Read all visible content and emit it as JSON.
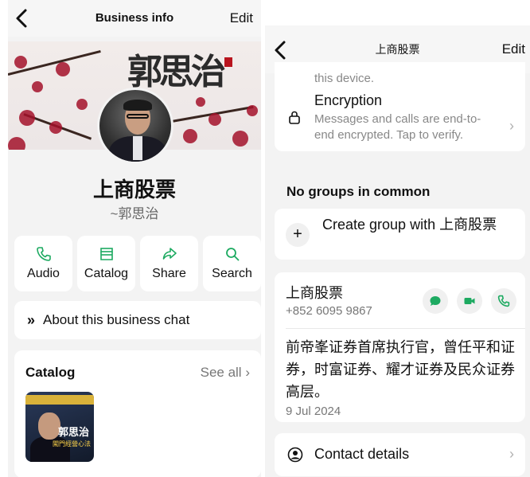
{
  "left": {
    "navbar": {
      "title": "Business info",
      "edit_label": "Edit"
    },
    "banner": {
      "calligraphy": "郭思治"
    },
    "business_name": "上商股票",
    "business_subtitle": "~郭思治",
    "actions": [
      {
        "label": "Audio",
        "icon": "phone-icon"
      },
      {
        "label": "Catalog",
        "icon": "storefront-icon"
      },
      {
        "label": "Share",
        "icon": "share-icon"
      },
      {
        "label": "Search",
        "icon": "search-icon"
      }
    ],
    "about": {
      "label": "About this business chat",
      "icon": "double-chevron-icon"
    },
    "catalog": {
      "title": "Catalog",
      "see_all": "See all",
      "thumb_title": "郭思治",
      "thumb_sub": "闖門經營心法"
    }
  },
  "right": {
    "navbar": {
      "title": "上商股票",
      "edit_label": "Edit"
    },
    "prev_text": "this device.",
    "encryption": {
      "title": "Encryption",
      "description": "Messages and calls are end-to-end encrypted. Tap to verify."
    },
    "groups_heading": "No groups in common",
    "create_group": {
      "label": "Create group with 上商股票"
    },
    "contact": {
      "name": "上商股票",
      "phone": "+852 6095 9867",
      "bio": "前帝峯证券首席执行官，曾任平和证券，时富证券、耀才证券及民众证券高层。",
      "date": "9 Jul 2024"
    },
    "contact_details": {
      "label": "Contact details"
    },
    "colors": {
      "green": "#1daa61",
      "chevron": "#b0b0b0"
    }
  }
}
